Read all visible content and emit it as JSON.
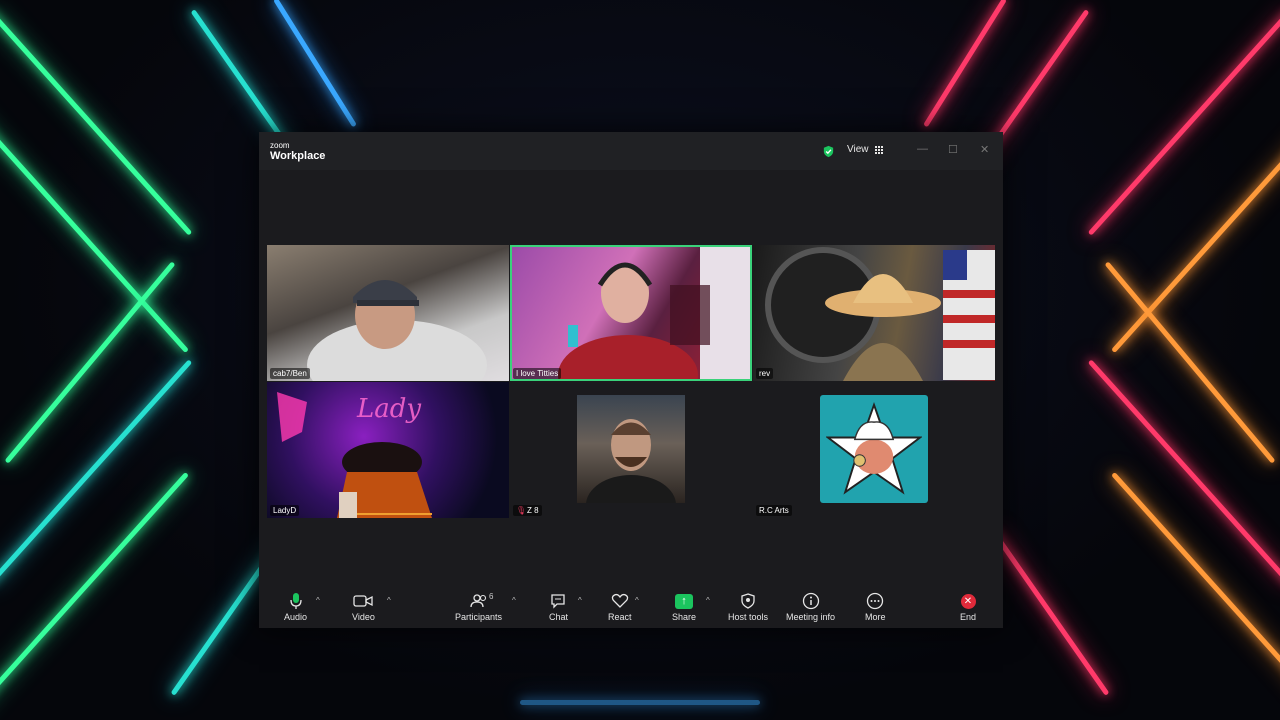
{
  "app": {
    "brand_small": "zoom",
    "brand_large": "Workplace"
  },
  "titlebar": {
    "view_label": "View",
    "min_glyph": "—",
    "max_glyph": "☐",
    "close_glyph": "✕"
  },
  "participants": [
    {
      "name": "cab7/Ben",
      "muted": false,
      "video": true
    },
    {
      "name": "I love Titties",
      "muted": false,
      "video": true,
      "active_speaker": true
    },
    {
      "name": "rev",
      "muted": false,
      "video": true
    },
    {
      "name": "LadyD",
      "muted": false,
      "video": true
    },
    {
      "name": "Z 8",
      "muted": true,
      "video": false
    },
    {
      "name": "R.C Arts",
      "muted": false,
      "video": false
    }
  ],
  "toolbar": {
    "audio": "Audio",
    "video": "Video",
    "participants": "Participants",
    "participants_count": "6",
    "chat": "Chat",
    "react": "React",
    "share": "Share",
    "host_tools": "Host tools",
    "meeting_info": "Meeting info",
    "more": "More",
    "end": "End",
    "caret": "^"
  },
  "colors": {
    "active_speaker": "#3ad27a",
    "share": "#1bc45e",
    "end": "#e02a3a",
    "secure": "#1bc45e"
  }
}
